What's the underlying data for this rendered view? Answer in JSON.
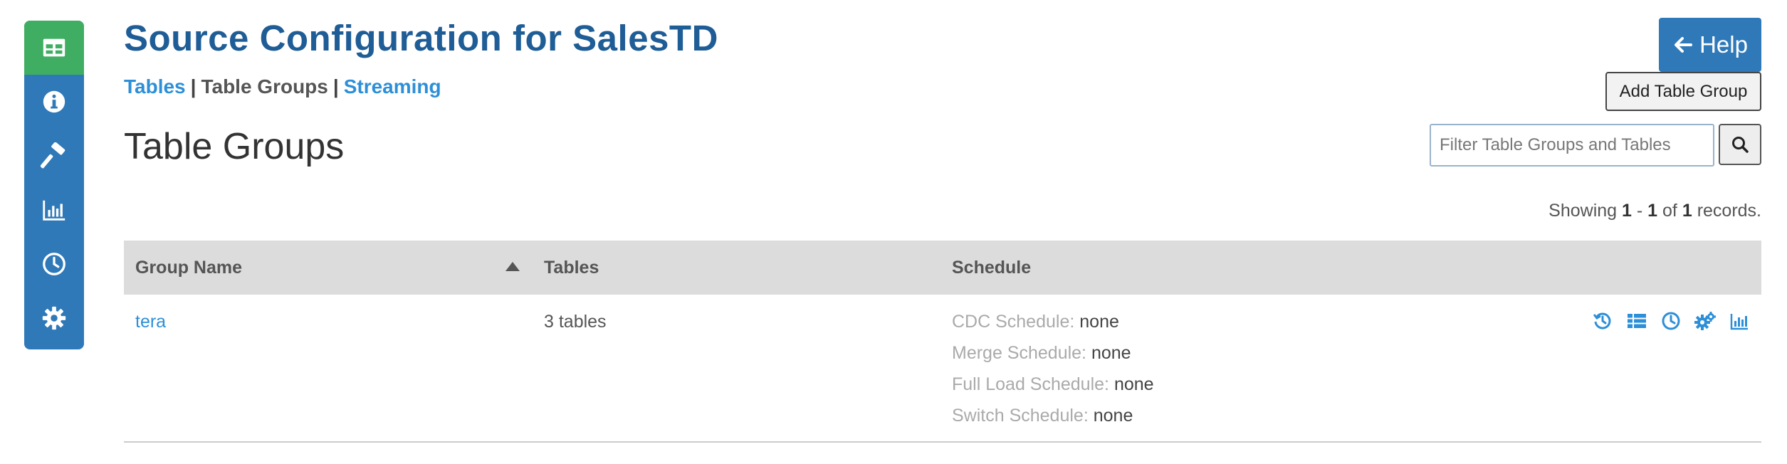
{
  "sidebar": {
    "items": [
      {
        "icon": "table-grid-icon",
        "active": true
      },
      {
        "icon": "info-icon",
        "active": false
      },
      {
        "icon": "hammer-icon",
        "active": false
      },
      {
        "icon": "bar-chart-icon",
        "active": false
      },
      {
        "icon": "clock-icon",
        "active": false
      },
      {
        "icon": "gear-icon",
        "active": false
      }
    ]
  },
  "header": {
    "title": "Source Configuration for SalesTD",
    "help_label": "Help",
    "help_icon": "arrow-left-icon"
  },
  "subnav": {
    "tables": "Tables",
    "sep1": "|",
    "table_groups": "Table Groups",
    "sep2": "|",
    "streaming": "Streaming"
  },
  "section": {
    "title": "Table Groups",
    "add_button": "Add Table Group",
    "filter_placeholder": "Filter Table Groups and Tables",
    "search_icon": "search-icon"
  },
  "records": {
    "prefix": "Showing",
    "start": "1",
    "dash": "-",
    "end": "1",
    "of": "of",
    "total": "1",
    "suffix": "records."
  },
  "table": {
    "columns": {
      "group_name": "Group Name",
      "tables": "Tables",
      "schedule": "Schedule"
    },
    "rows": [
      {
        "group_name": "tera",
        "tables": "3 tables",
        "cdc_label": "CDC Schedule:",
        "cdc_value": "none",
        "merge_label": "Merge Schedule:",
        "merge_value": "none",
        "full_label": "Full Load Schedule:",
        "full_value": "none",
        "switch_label": "Switch Schedule:",
        "switch_value": "none",
        "actions": [
          "history-icon",
          "list-icon",
          "clock-icon",
          "gears-icon",
          "bar-chart-icon"
        ]
      }
    ]
  },
  "colors": {
    "primary": "#2f79b9",
    "active": "#3fae62",
    "title": "#1f5d96",
    "link": "#2d8fd8"
  }
}
